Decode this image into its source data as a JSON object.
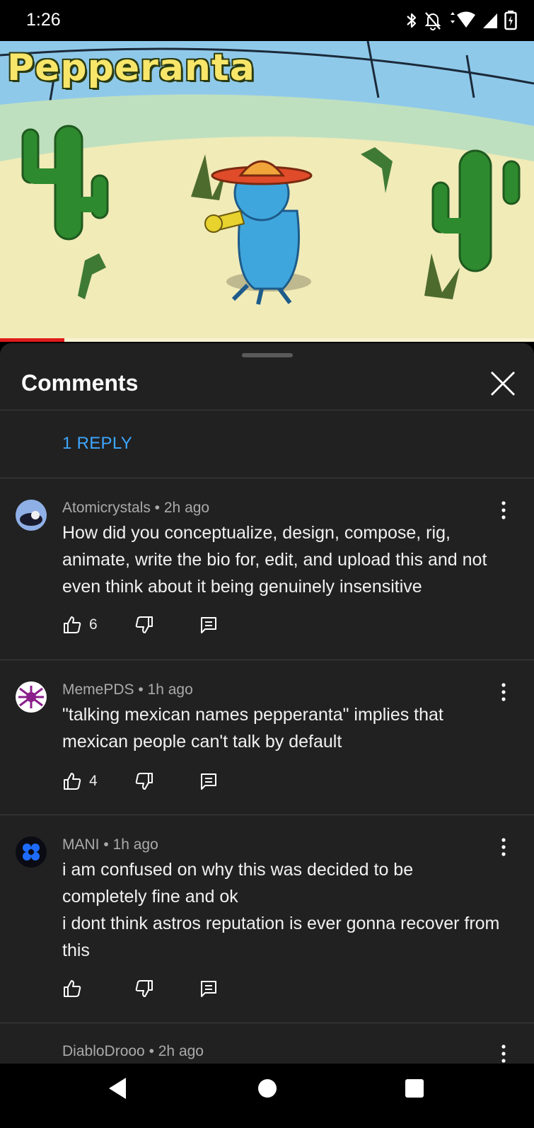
{
  "status": {
    "time": "1:26"
  },
  "video": {
    "title_text": "Pepperanta",
    "progress_fraction": 0.12
  },
  "sheet": {
    "title": "Comments",
    "reply_link": "1 REPLY"
  },
  "comments": [
    {
      "author": "Atomicrystals",
      "age": "2h ago",
      "meta": "Atomicrystals • 2h ago",
      "text": "How did you conceptualize, design, compose, rig, animate, write the bio for, edit, and upload this and not even think about it being genuinely insensitive",
      "likes": "6"
    },
    {
      "author": "MemePDS",
      "age": "1h ago",
      "meta": "MemePDS • 1h ago",
      "text": "\"talking mexican names pepperanta\" implies that mexican people can't talk by default",
      "likes": "4"
    },
    {
      "author": "MANI",
      "age": "1h ago",
      "meta": "MANI • 1h ago",
      "text": "i am confused on why this was decided to be completely fine and ok\ni dont think astros reputation is ever gonna recover from this",
      "likes": ""
    },
    {
      "author": "DiabloDrooo",
      "age": "2h ago",
      "meta": "DiabloDrooo • 2h ago",
      "text": "",
      "likes": ""
    }
  ],
  "colors": {
    "sheet_bg": "#212121",
    "link_blue": "#3ea6ff",
    "progress_red": "#e01b1b",
    "divider": "#3d3d3d"
  },
  "icons": [
    "bluetooth-icon",
    "bell-off-icon",
    "wifi-icon",
    "cell-signal-icon",
    "battery-icon",
    "close-icon",
    "more-vert-icon",
    "thumb-up-icon",
    "thumb-down-icon",
    "reply-icon",
    "nav-back-icon",
    "nav-home-icon",
    "nav-recents-icon"
  ]
}
